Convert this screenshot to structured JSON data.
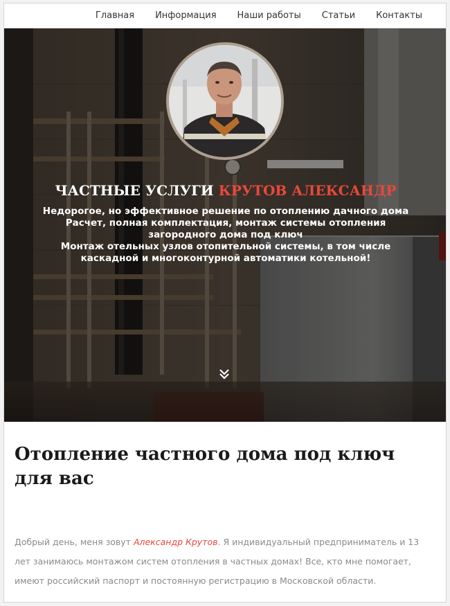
{
  "nav": {
    "items": [
      {
        "label": "Главная"
      },
      {
        "label": "Информация"
      },
      {
        "label": "Наши работы"
      },
      {
        "label": "Статьи"
      },
      {
        "label": "Контакты"
      }
    ]
  },
  "hero": {
    "title_plain": "ЧАСТНЫЕ УСЛУГИ",
    "title_accent": "КРУТОВ АЛЕКСАНДР",
    "lines": [
      "Недорогое, но эффективное решение по отоплению дачного дома",
      "Расчет, полная комплектация, монтаж системы отопления загородного дома под ключ",
      "Монтаж отельных узлов отопительной системы, в том числе каскадной и многоконтурной автоматики котельной!"
    ],
    "scroll_icon": "chevron-double-down-icon"
  },
  "content": {
    "title": "Отопление частного дома под ключ для вас",
    "intro_before": "Добрый день, меня зовут ",
    "intro_name": "Александр Крутов",
    "intro_after": ". Я индивидуальный предприниматель и 13 лет занимаюсь монтажом систем отопления в частных домах! Все, кто мне помогает, имеют российский паспорт и постоянную регистрацию в Московской области."
  },
  "colors": {
    "accent": "#e8483b",
    "hero_overlay": "#2e2a26",
    "nav_bg": "#ffffff",
    "text_muted": "#8a8a8a"
  }
}
